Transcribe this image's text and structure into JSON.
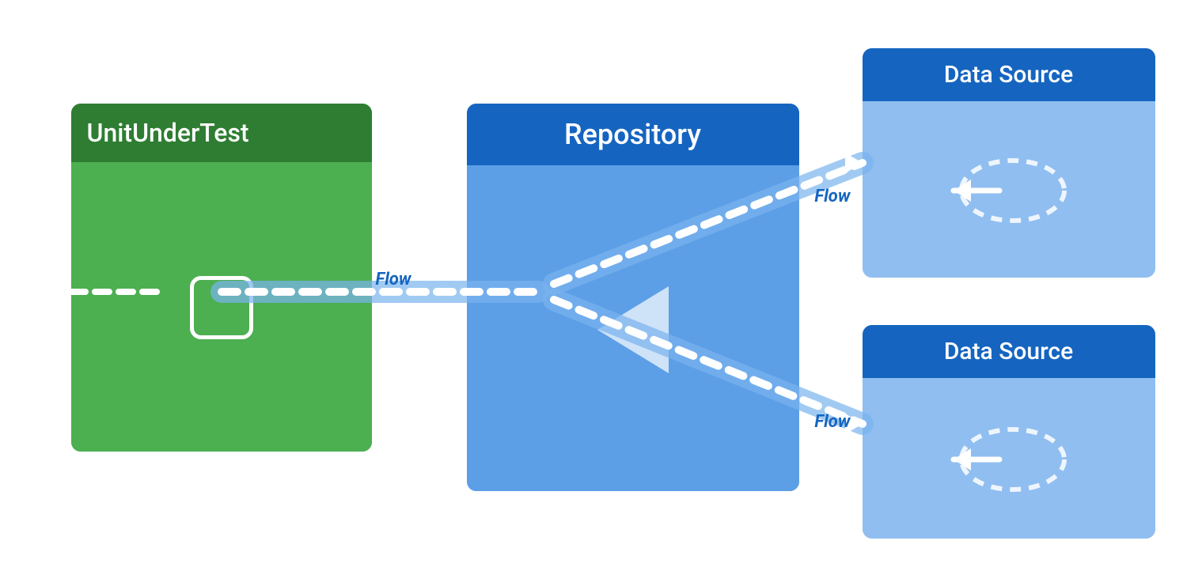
{
  "unit_under_test": {
    "title": "UnitUnderTest"
  },
  "repository": {
    "title": "Repository"
  },
  "data_source_top": {
    "title": "Data Source"
  },
  "data_source_bottom": {
    "title": "Data Source"
  },
  "flow_labels": {
    "middle": "Flow",
    "top": "Flow",
    "bottom": "Flow"
  },
  "colors": {
    "green_dark": "#2e7d32",
    "green_mid": "#4caf50",
    "blue_dark": "#1565c0",
    "blue_mid": "#5c9fe6",
    "blue_light": "#90bef0",
    "white": "#ffffff"
  }
}
